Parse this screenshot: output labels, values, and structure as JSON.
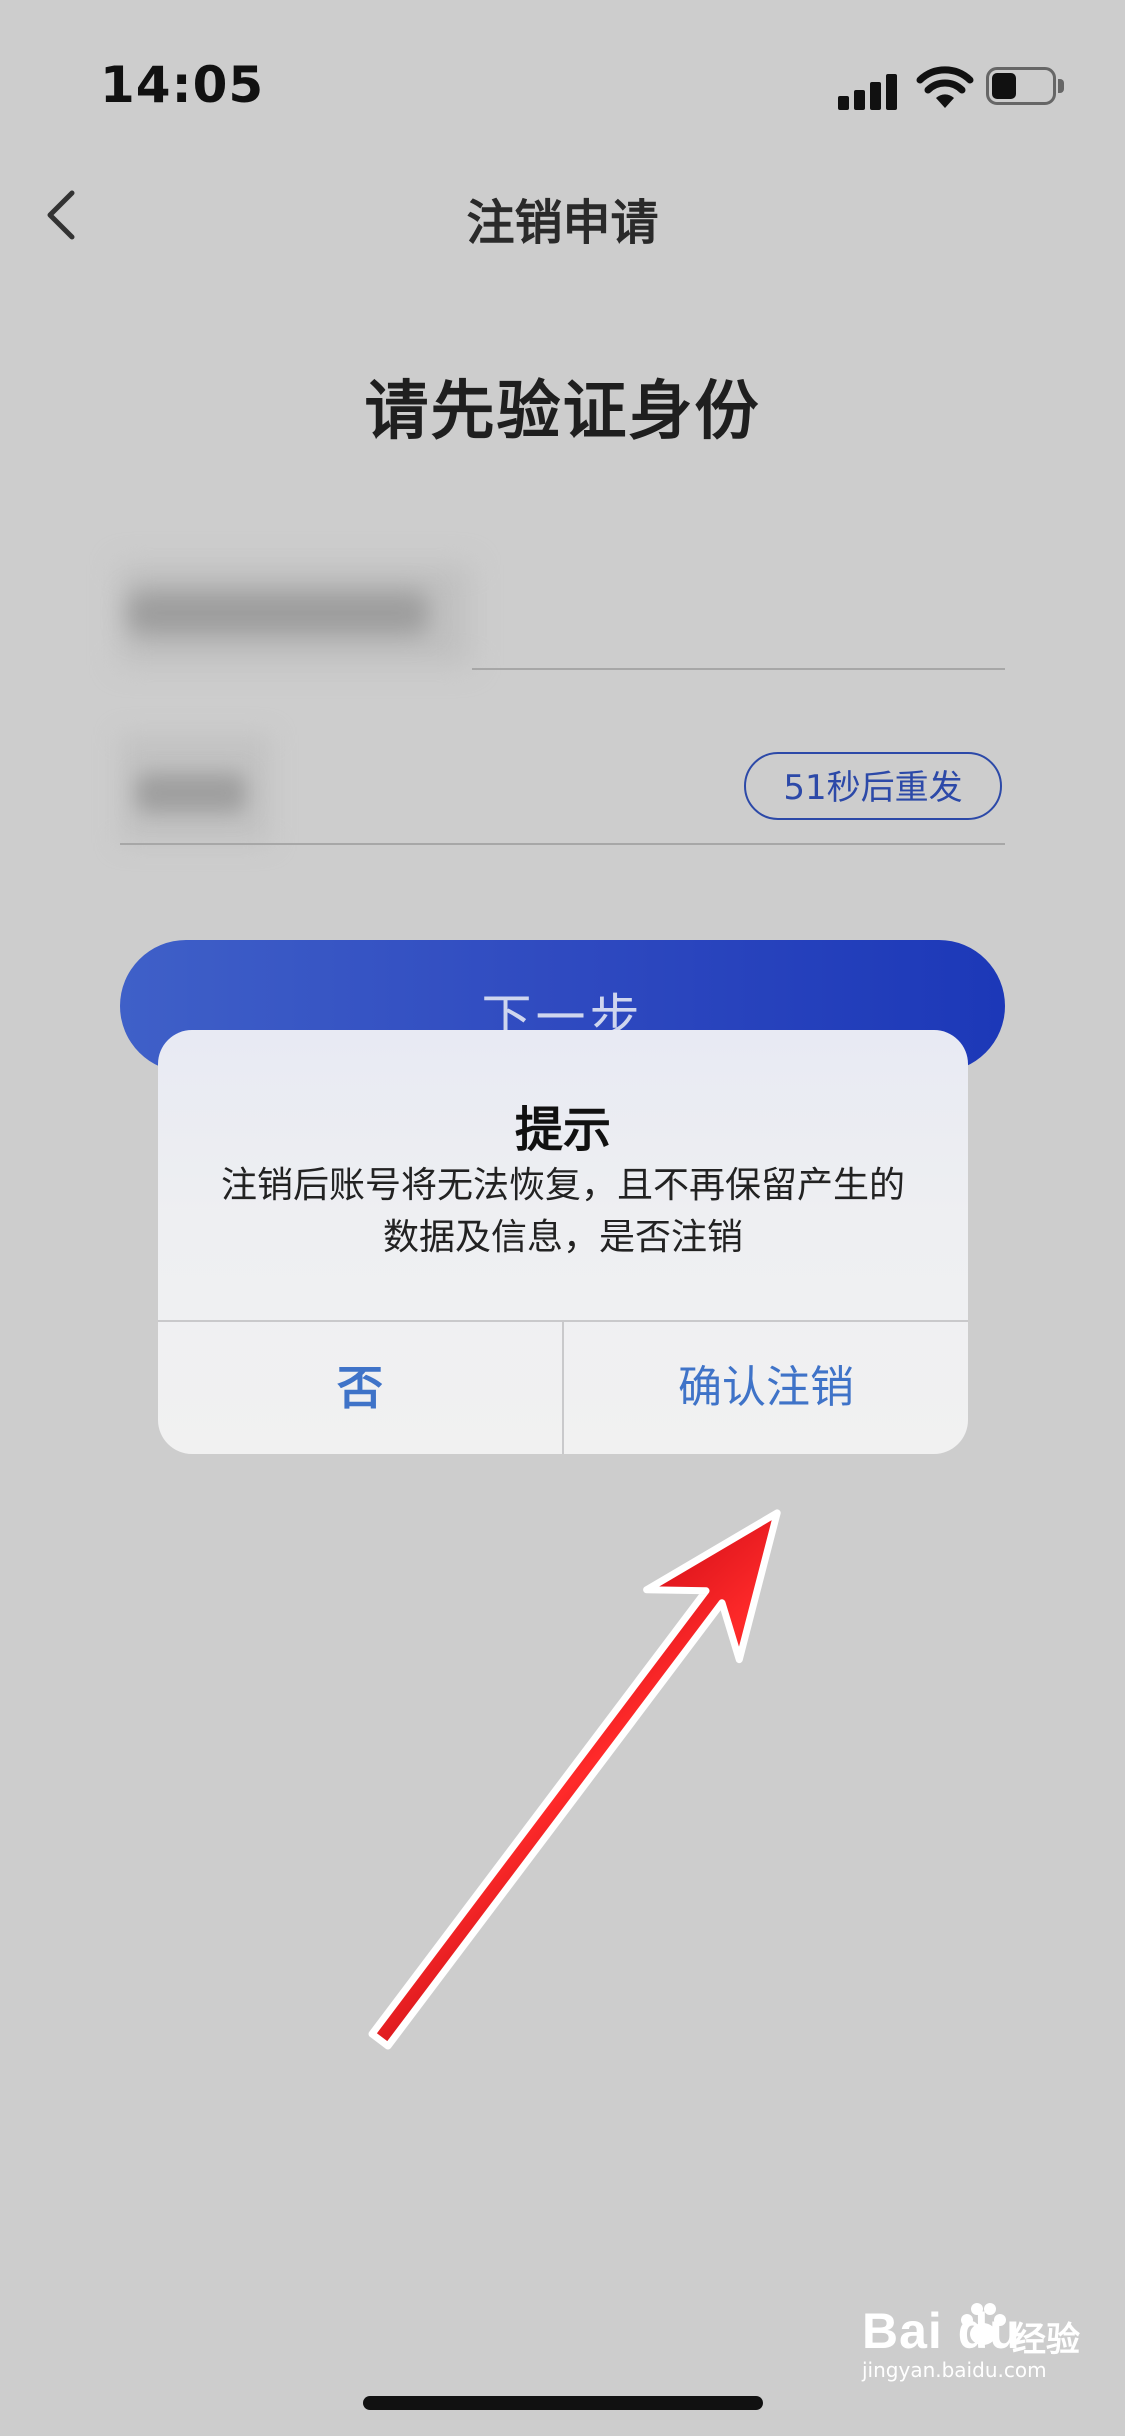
{
  "status_bar": {
    "time": "14:05"
  },
  "nav": {
    "title": "注销申请"
  },
  "page": {
    "heading": "请先验证身份"
  },
  "form": {
    "resend_label": "51秒后重发",
    "next_label": "下一步"
  },
  "dialog": {
    "title": "提示",
    "message": "注销后账号将无法恢复，且不再保留产生的数据及信息，是否注销",
    "cancel_label": "否",
    "confirm_label": "确认注销"
  },
  "watermark": {
    "brand": "Bai du",
    "brand_cn": "经验",
    "url": "jingyan.baidu.com"
  },
  "colors": {
    "accent": "#3f73c8",
    "button": "#2f4ac0",
    "arrow": "#e3141c",
    "overlay": "#cdcdcd"
  }
}
